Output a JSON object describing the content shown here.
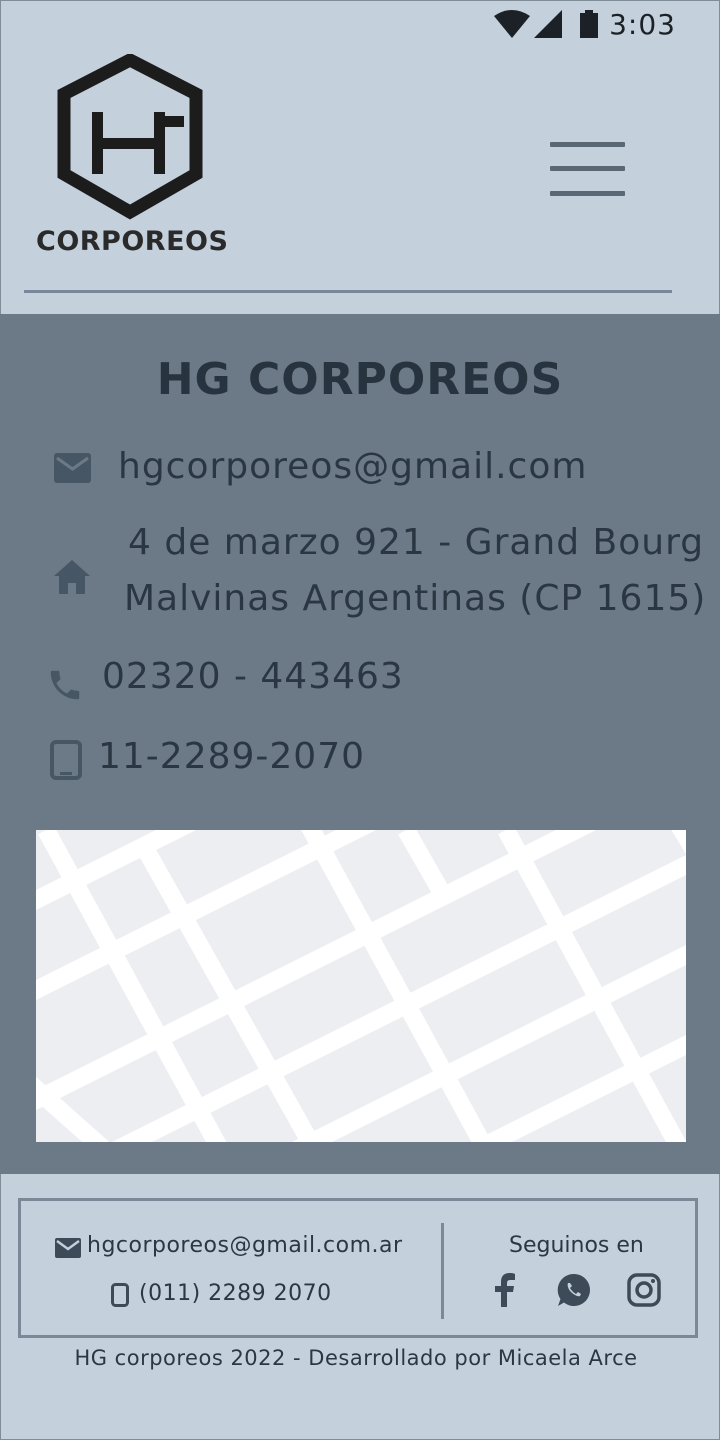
{
  "status_bar": {
    "time": "3:03"
  },
  "header": {
    "logo_text": "CORPOREOS"
  },
  "contact": {
    "title": "HG CORPOREOS",
    "email": "hgcorporeos@gmail.com",
    "address_line1": "4 de marzo 921 - Grand Bourg",
    "address_line2": "Malvinas Argentinas (CP 1615)",
    "phone": "02320 - 443463",
    "mobile": "11-2289-2070"
  },
  "footer": {
    "email": "hgcorporeos@gmail.com.ar",
    "phone": "(011) 2289 2070",
    "follow_label": "Seguinos en",
    "credit": "HG corporeos 2022 - Desarrollado por Micaela Arce"
  },
  "icons": {
    "wifi": "wifi-icon",
    "signal": "signal-icon",
    "battery": "battery-icon",
    "menu": "hamburger-menu-icon",
    "email": "envelope-icon",
    "home": "home-icon",
    "phone": "phone-icon",
    "mobile": "mobile-icon",
    "facebook": "facebook-icon",
    "whatsapp": "whatsapp-icon",
    "instagram": "instagram-icon"
  },
  "colors": {
    "page_bg": "#c4d1dc",
    "section_bg": "#6c7a87",
    "text_dark": "#27343f",
    "accent_line": "#78879a"
  }
}
